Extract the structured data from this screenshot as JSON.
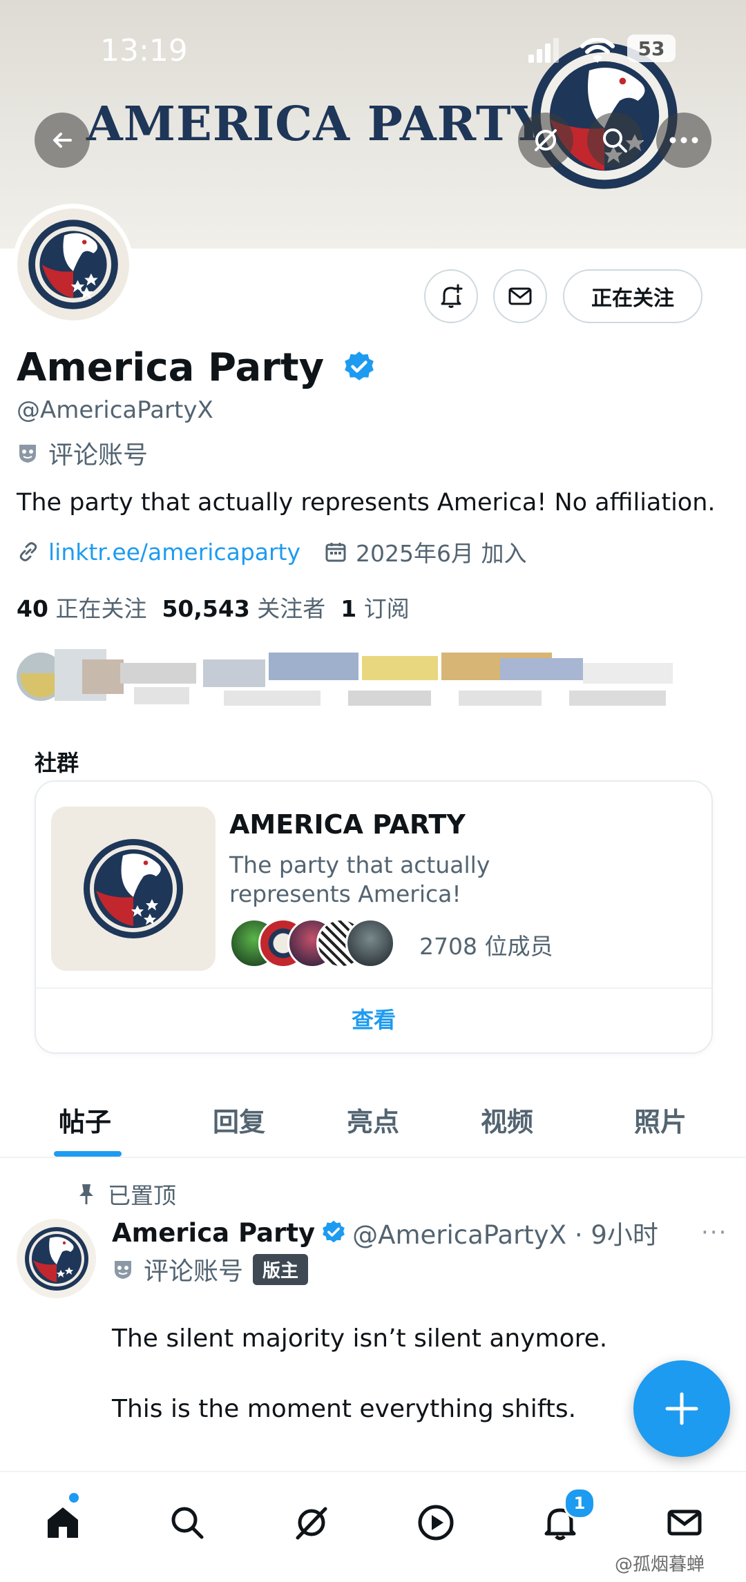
{
  "status_bar": {
    "time": "13:19",
    "battery": "53"
  },
  "banner": {
    "title": "AMERICA PARTY"
  },
  "profile": {
    "display_name": "America Party",
    "handle": "@AmericaPartyX",
    "account_type": "评论账号",
    "bio": "The party that actually represents America! No affiliation.",
    "link": "linktr.ee/americaparty",
    "joined": "2025年6月 加入",
    "follow_button": "正在关注",
    "stats": {
      "following_count": "40",
      "following_label": "正在关注",
      "followers_count": "50,543",
      "followers_label": "关注者",
      "subs_count": "1",
      "subs_label": "订阅"
    }
  },
  "community": {
    "section_label": "社群",
    "name": "AMERICA PARTY",
    "description": "The party that actually represents America!",
    "member_count": "2708 位成员",
    "view_label": "查看"
  },
  "tabs": [
    "帖子",
    "回复",
    "亮点",
    "视频",
    "照片"
  ],
  "post": {
    "pinned_label": "已置顶",
    "author": "America Party",
    "handle_time": "@AmericaPartyX · 9小时",
    "account_type": "评论账号",
    "badge": "版主",
    "line1": "The silent majority isn’t silent anymore.",
    "line2": "This is the moment everything shifts.",
    "more": "···"
  },
  "bottom_nav": {
    "notifications_badge": "1"
  },
  "watermark": "@孤烟暮蝉",
  "colors": {
    "accent": "#1d9bf0",
    "navy": "#1e3658",
    "red": "#c2272d"
  }
}
